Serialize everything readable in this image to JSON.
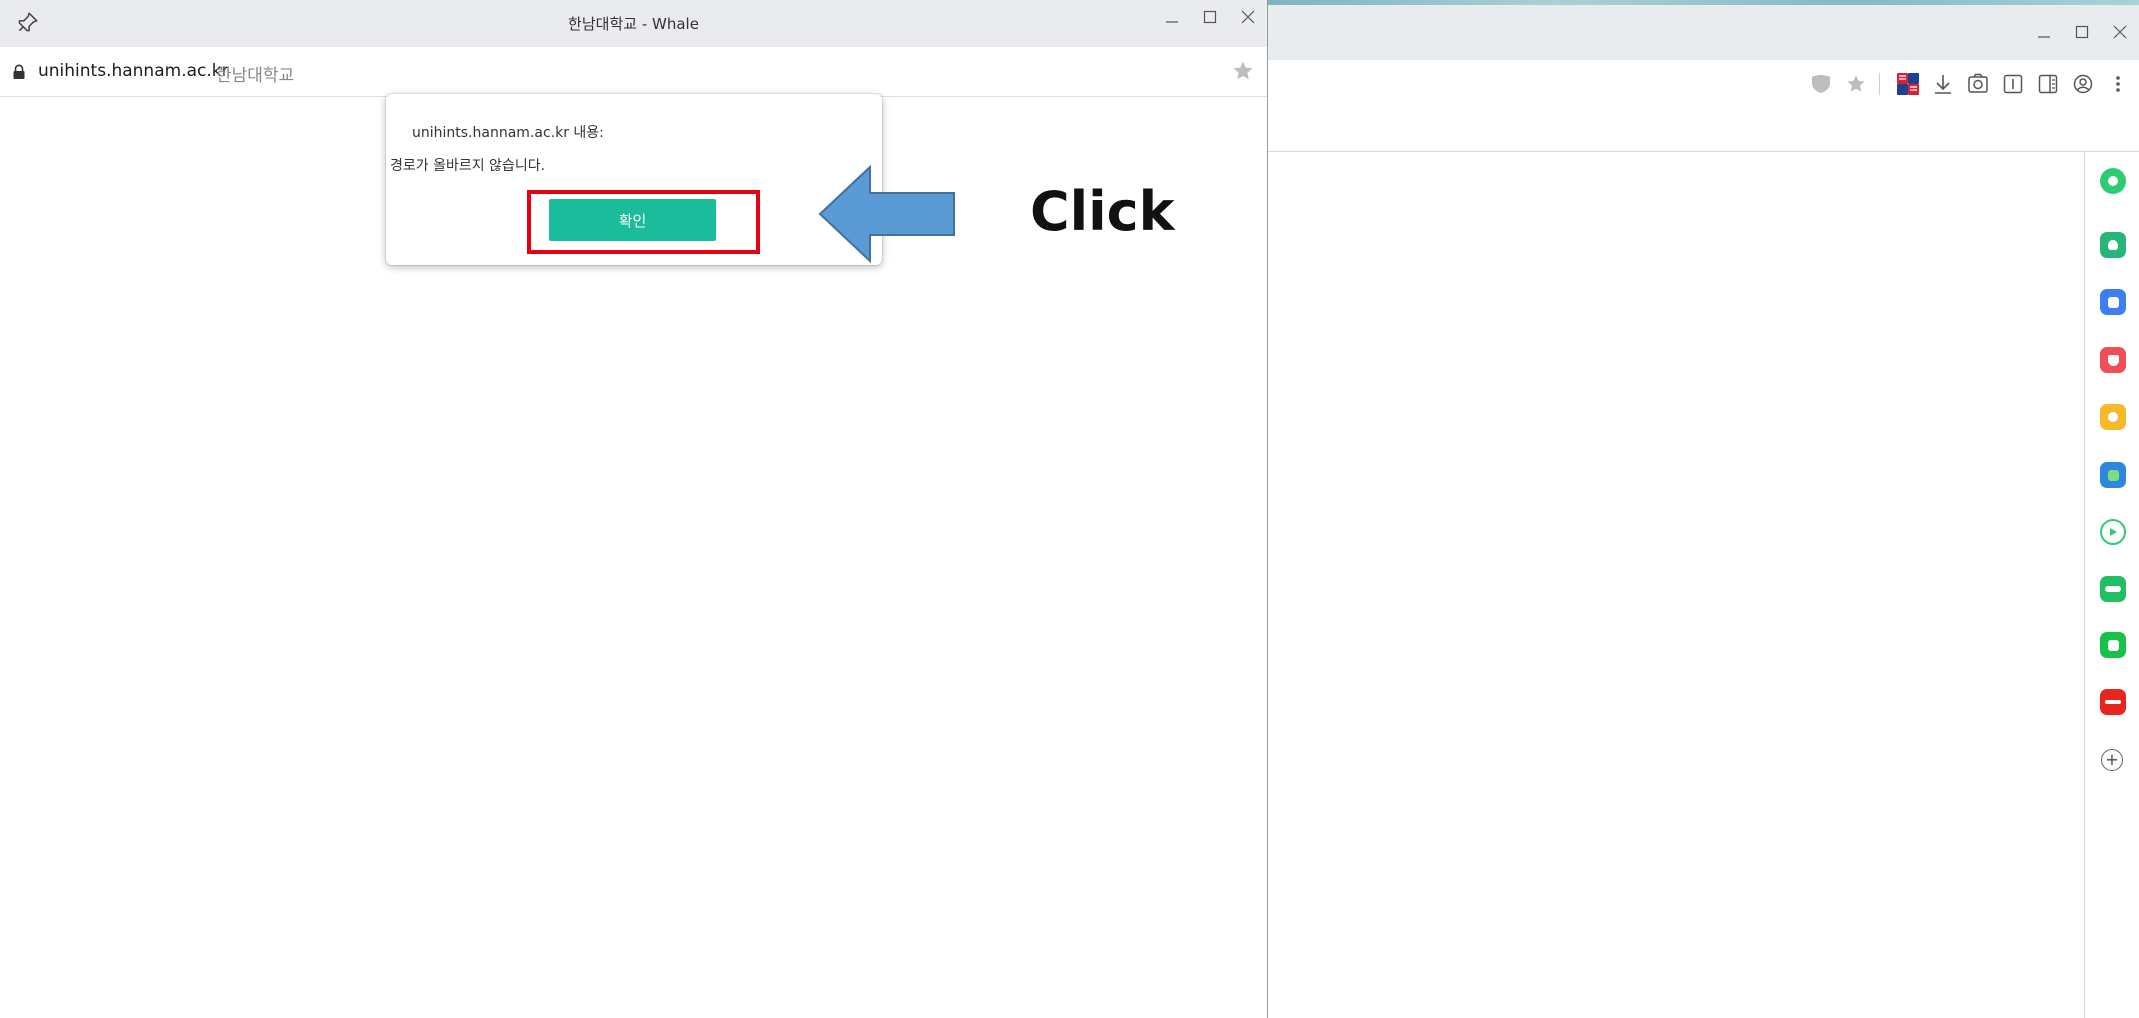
{
  "popup": {
    "title": "한남대학교 - Whale",
    "url_host": "unihints.hannam.ac.kr",
    "url_title": "한남대학교"
  },
  "dialog": {
    "origin": "unihints.hannam.ac.kr 내용:",
    "message": "경로가 올바르지 않습니다.",
    "confirm_label": "확인"
  },
  "annotation": {
    "label": "Click",
    "highlight_color": "#e60012",
    "arrow_color": "#5b9bd5"
  },
  "colors": {
    "confirm_button": "#1abc9c",
    "titlebar": "#e9ebee"
  },
  "main_window": {
    "toolbar_icons": [
      "shield-icon",
      "star-icon",
      "translate-icon",
      "download-icon",
      "capture-icon",
      "reader-icon",
      "sidebar-icon",
      "account-icon",
      "more-icon"
    ],
    "sidebar_apps": [
      "green-circle-app",
      "notification-app",
      "calendar-app",
      "pocket-app",
      "favorites-app",
      "translate-app",
      "media-app",
      "webtoon-app",
      "chat-app",
      "mom-app",
      "add-app"
    ]
  }
}
